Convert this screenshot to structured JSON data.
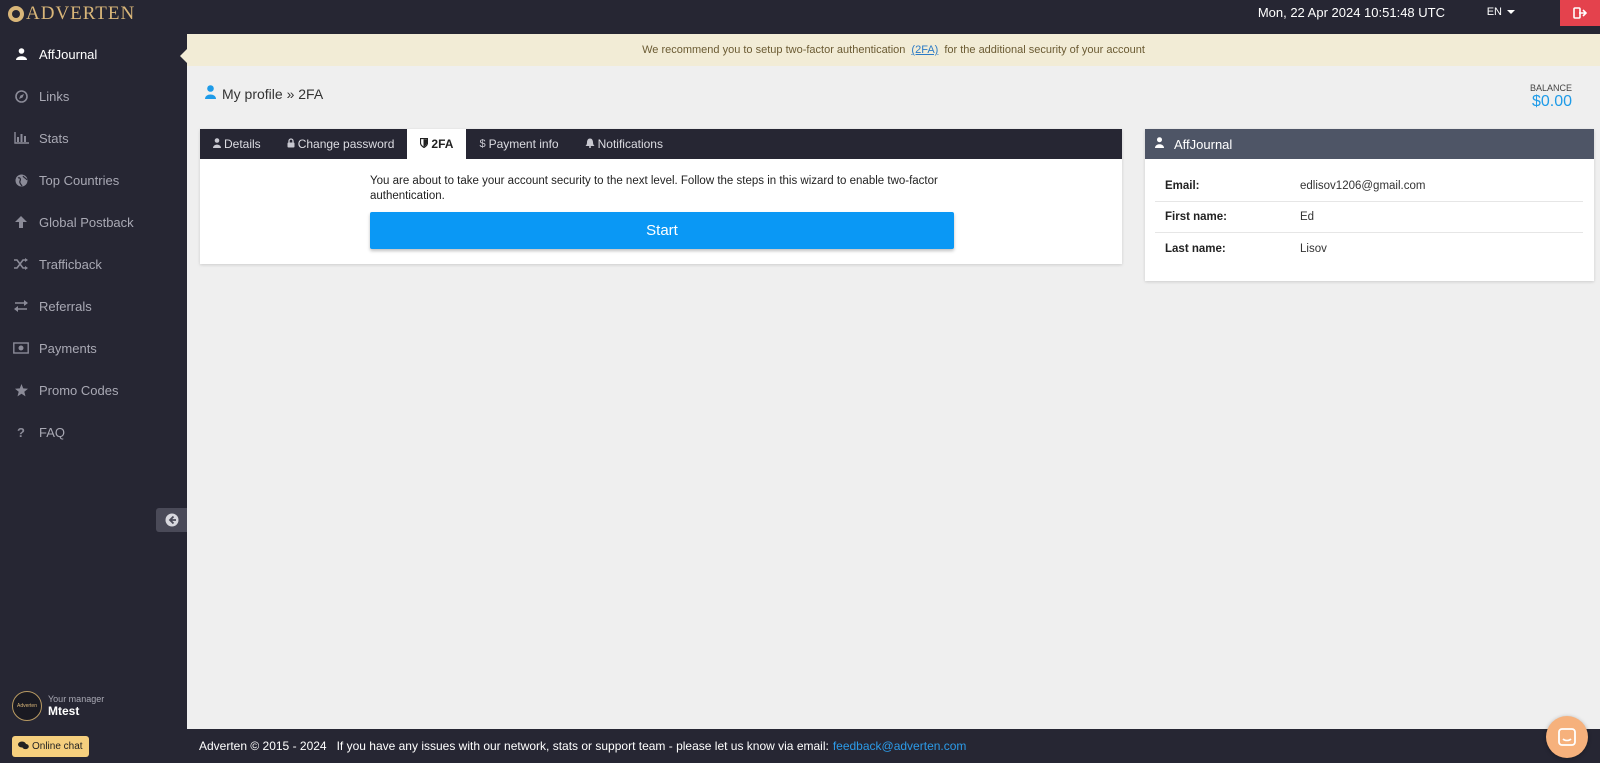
{
  "brand": {
    "name": "ADVERTEN"
  },
  "topbar": {
    "datetime": "Mon, 22 Apr 2024 10:51:48 UTC",
    "language": "EN",
    "logout_icon": "logout-icon"
  },
  "sidebar": {
    "items": [
      {
        "label": "AffJournal",
        "icon": "user-icon",
        "active": true
      },
      {
        "label": "Links",
        "icon": "compass-icon"
      },
      {
        "label": "Stats",
        "icon": "bar-chart-icon"
      },
      {
        "label": "Top Countries",
        "icon": "globe-icon"
      },
      {
        "label": "Global Postback",
        "icon": "arrow-up-icon"
      },
      {
        "label": "Trafficback",
        "icon": "shuffle-icon"
      },
      {
        "label": "Referrals",
        "icon": "exchange-icon"
      },
      {
        "label": "Payments",
        "icon": "money-icon"
      },
      {
        "label": "Promo Codes",
        "icon": "star-icon"
      },
      {
        "label": "FAQ",
        "icon": "question-icon"
      }
    ],
    "manager": {
      "label": "Your manager",
      "name": "Mtest",
      "avatar_text": "Adverten"
    },
    "online_chat": "Online chat"
  },
  "notice": {
    "before": "We recommend you to setup two-factor authentication",
    "link": "(2FA)",
    "after": "for the additional security of your account"
  },
  "breadcrumb": {
    "text": "My profile » 2FA"
  },
  "balance": {
    "label": "BALANCE",
    "value": "$0.00"
  },
  "tabs": [
    {
      "label": "Details",
      "icon": "user-icon"
    },
    {
      "label": "Change password",
      "icon": "lock-icon"
    },
    {
      "label": "2FA",
      "icon": "shield-icon",
      "active": true
    },
    {
      "label": "Payment info",
      "icon": "dollar-icon"
    },
    {
      "label": "Notifications",
      "icon": "bell-icon"
    }
  ],
  "twofa": {
    "text": "You are about to take your account security to the next level. Follow the steps in this wizard to enable two-factor authentication.",
    "start_label": "Start"
  },
  "profile_card": {
    "title": "AffJournal",
    "rows": [
      {
        "key": "Email:",
        "value": "edlisov1206@gmail.com"
      },
      {
        "key": "First name:",
        "value": "Ed"
      },
      {
        "key": "Last name:",
        "value": "Lisov"
      }
    ]
  },
  "footer": {
    "copyright": "Adverten © 2015 - 2024",
    "message": "If you have any issues with our network, stats or support team - please let us know via email:",
    "email": "feedback@adverten.com"
  },
  "colors": {
    "accent": "#0a98f5",
    "sidebar": "#262633",
    "notice_bg": "#f2ecd6",
    "logout": "#e4424d"
  }
}
